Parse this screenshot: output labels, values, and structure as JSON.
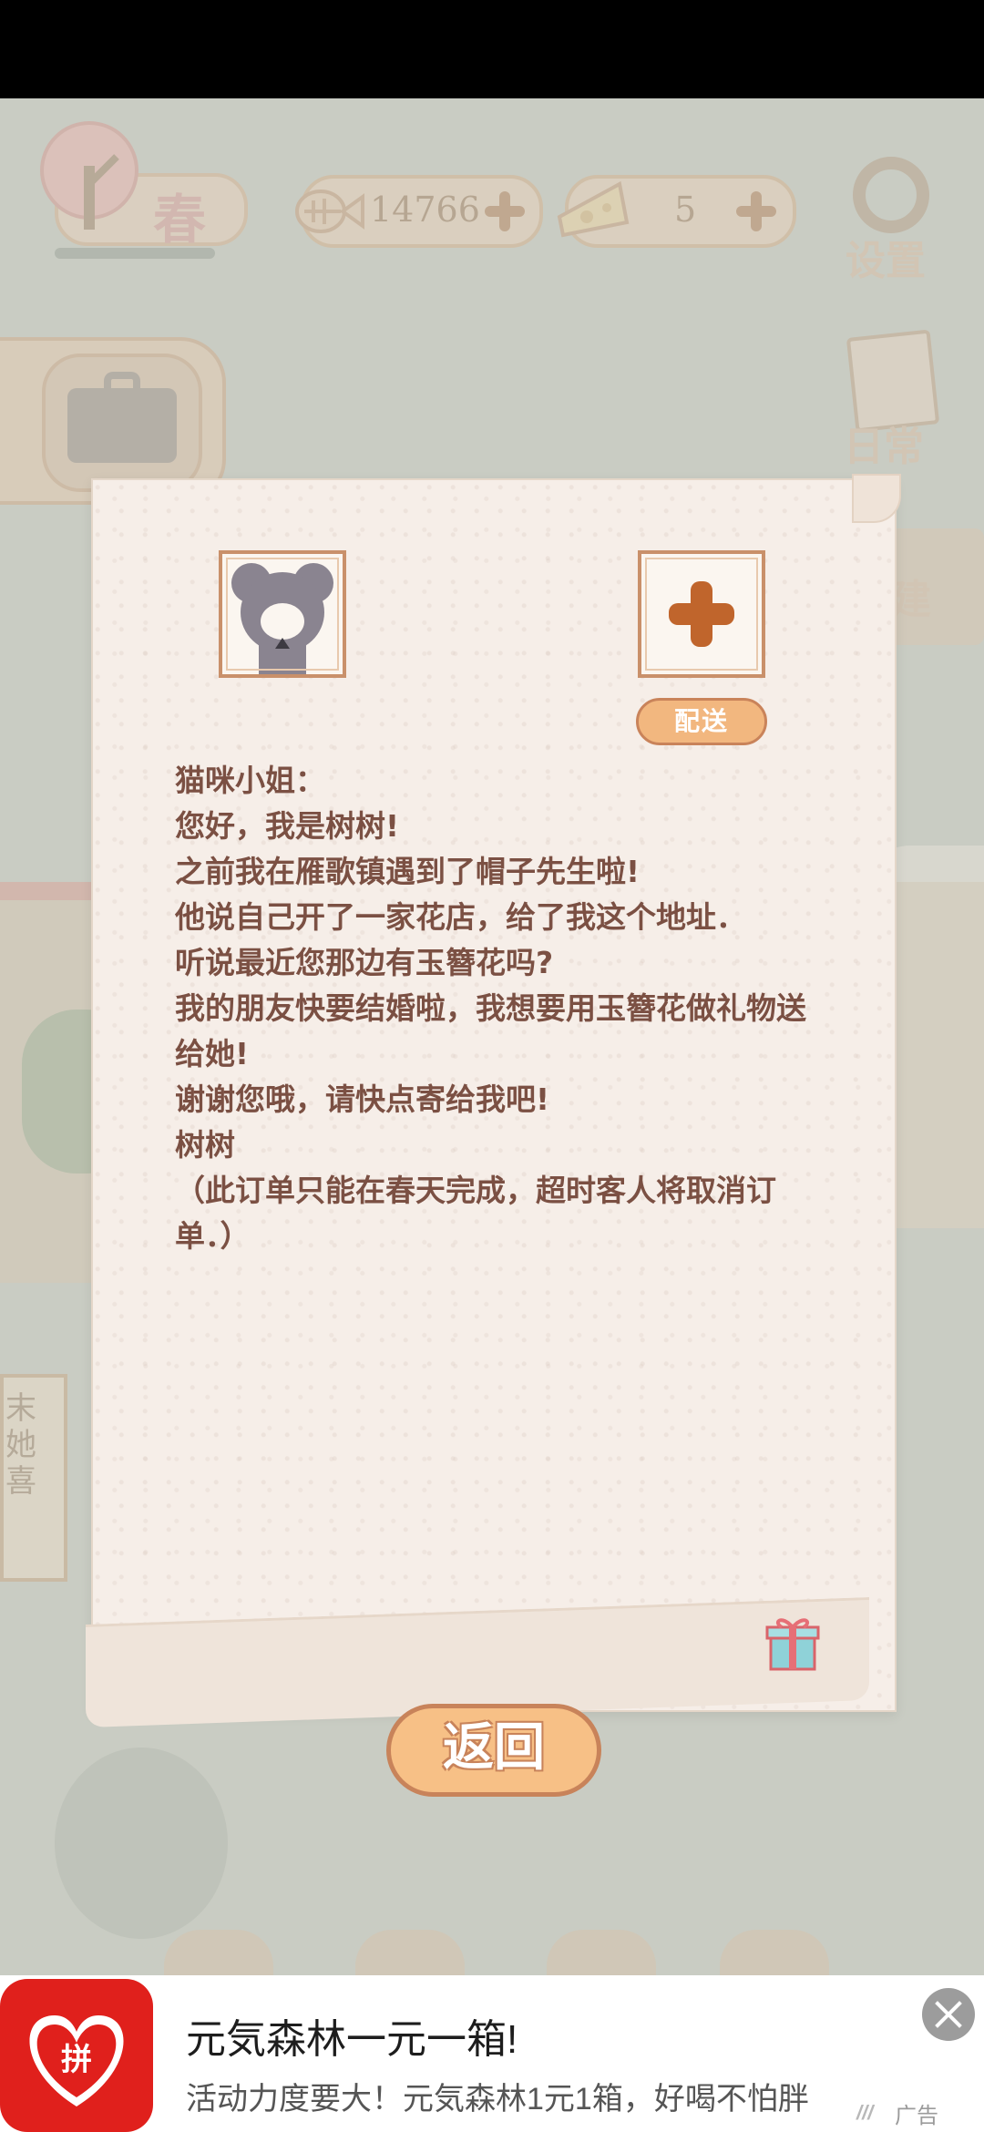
{
  "hud": {
    "season": "春",
    "fish_count": "14766",
    "cheese_count": "5",
    "settings_label": "设置",
    "daily_label": "日常",
    "build_label": "建"
  },
  "background": {
    "sign_text": "末她喜"
  },
  "letter": {
    "deliver_label": "配送",
    "lines": [
      "猫咪小姐：",
      "您好，我是树树!",
      "之前我在雁歌镇遇到了帽子先生啦!",
      "他说自己开了一家花店，给了我这个地址．",
      "听说最近您那边有玉簪花吗?",
      "我的朋友快要结婚啦，我想要用玉簪花做礼物送给她!",
      "谢谢您哦，请快点寄给我吧!",
      "树树",
      "（此订单只能在春天完成，超时客人将取消订单．）"
    ],
    "return_label": "返回"
  },
  "ad": {
    "logo_text": "拼",
    "title": "元気森林一元一箱!",
    "description": "活动力度要大！元気森林1元1箱，好喝不怕胖",
    "label": "广告",
    "mark": "///",
    "colors": {
      "logo_bg": "#e0201c"
    }
  }
}
